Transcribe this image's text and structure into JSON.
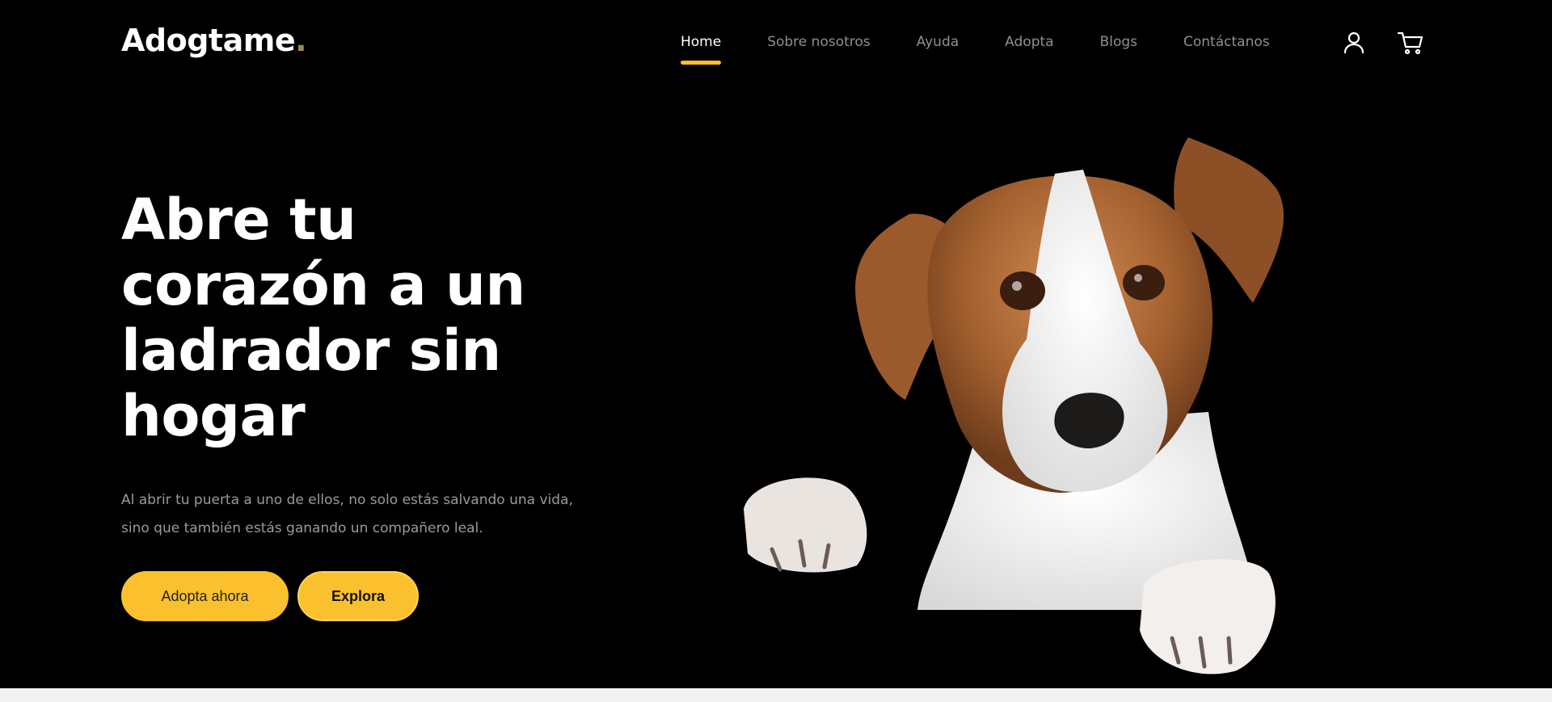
{
  "brand": {
    "name": "Adogtame",
    "dot": "."
  },
  "nav": {
    "items": [
      {
        "label": "Home",
        "active": true
      },
      {
        "label": "Sobre nosotros",
        "active": false
      },
      {
        "label": "Ayuda",
        "active": false
      },
      {
        "label": "Adopta",
        "active": false
      },
      {
        "label": "Blogs",
        "active": false
      },
      {
        "label": "Contáctanos",
        "active": false
      }
    ],
    "icons": [
      "user-icon",
      "cart-icon"
    ]
  },
  "hero": {
    "title": "Abre tu corazón a un ladrador sin hogar",
    "description": "Al abrir tu puerta a uno de ellos, no solo estás salvando una vida, sino que también estás ganando un compañero leal.",
    "primary_button": "Adopta ahora",
    "secondary_button": "Explora"
  },
  "colors": {
    "accent": "#fbc02d",
    "background": "#000000",
    "muted_text": "#9a9a9a"
  }
}
